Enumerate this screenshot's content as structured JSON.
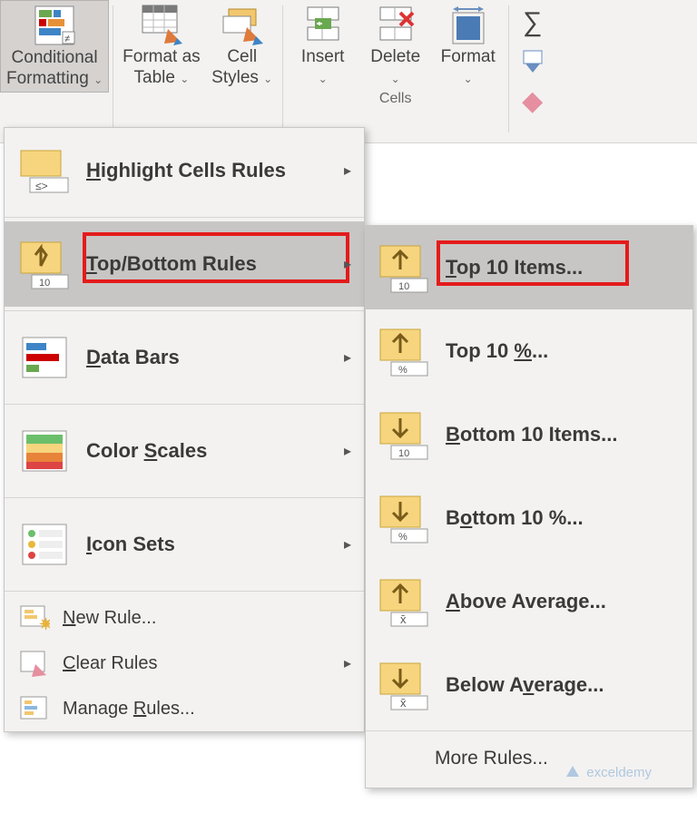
{
  "ribbon": {
    "conditional_formatting": "Conditional\nFormatting",
    "format_as_table": "Format as\nTable",
    "cell_styles": "Cell\nStyles",
    "insert": "Insert",
    "delete": "Delete",
    "format": "Format",
    "cells_group": "Cells"
  },
  "menu": {
    "highlight_cells": "Highlight Cells Rules",
    "top_bottom": "Top/Bottom Rules",
    "data_bars": "Data Bars",
    "color_scales": "Color Scales",
    "icon_sets": "Icon Sets",
    "new_rule": "New Rule...",
    "clear_rules": "Clear Rules",
    "manage_rules": "Manage Rules..."
  },
  "submenu": {
    "top10_items": "Top 10 Items...",
    "top10_percent": "Top 10 %...",
    "bottom10_items": "Bottom 10 Items...",
    "bottom10_percent": "Bottom 10 %...",
    "above_avg": "Above Average...",
    "below_avg": "Below Average...",
    "more_rules": "More Rules..."
  },
  "watermark": "exceldemy"
}
